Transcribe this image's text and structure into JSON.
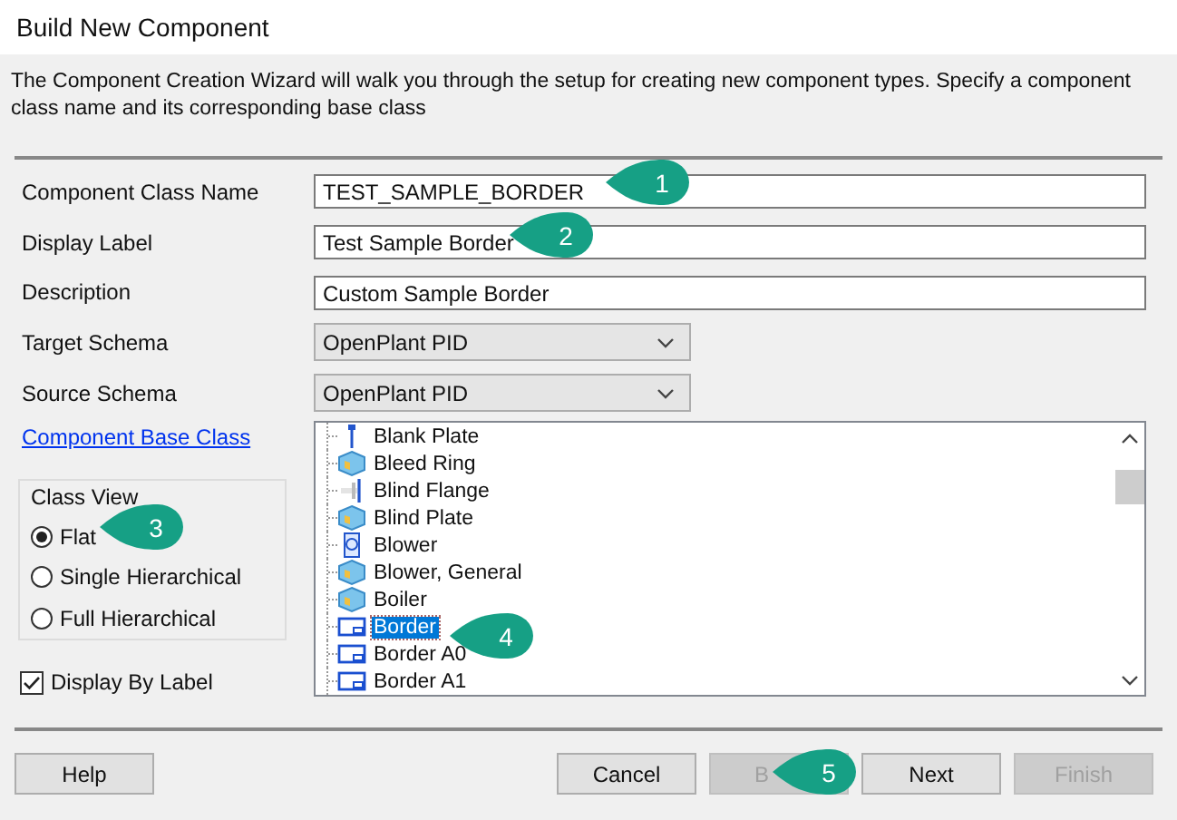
{
  "window": {
    "title": "Build New Component"
  },
  "intro": "The Component Creation Wizard will walk you through the setup for creating new component types.  Specify a component class name and its corresponding base class",
  "fields": [
    {
      "kind": "text",
      "label": "Component Class Name",
      "value": "TEST_SAMPLE_BORDER"
    },
    {
      "kind": "text",
      "label": "Display Label",
      "value": "Test Sample Border"
    },
    {
      "kind": "text",
      "label": "Description",
      "value": "Custom Sample Border"
    },
    {
      "kind": "select",
      "label": "Target Schema",
      "value": "OpenPlant PID"
    },
    {
      "kind": "select",
      "label": "Source Schema",
      "value": "OpenPlant PID"
    }
  ],
  "base_class_link": "Component Base Class",
  "class_view": {
    "title": "Class View",
    "options": [
      {
        "label": "Flat",
        "selected": true
      },
      {
        "label": "Single Hierarchical",
        "selected": false
      },
      {
        "label": "Full Hierarchical",
        "selected": false
      }
    ]
  },
  "display_by_label": {
    "label": "Display By Label",
    "checked": true
  },
  "tree": [
    {
      "label": "Blank Plate",
      "kind": "pin",
      "selected": false
    },
    {
      "label": "Bleed Ring",
      "kind": "cube",
      "selected": false
    },
    {
      "label": "Blind Flange",
      "kind": "flange",
      "selected": false
    },
    {
      "label": "Blind Plate",
      "kind": "cube",
      "selected": false
    },
    {
      "label": "Blower",
      "kind": "blower",
      "selected": false
    },
    {
      "label": "Blower, General",
      "kind": "cube",
      "selected": false
    },
    {
      "label": "Boiler",
      "kind": "cube",
      "selected": false
    },
    {
      "label": "Border",
      "kind": "frame",
      "selected": true
    },
    {
      "label": "Border A0",
      "kind": "frame",
      "selected": false
    },
    {
      "label": "Border A1",
      "kind": "frame",
      "selected": false
    }
  ],
  "buttons": [
    {
      "label": "Help",
      "disabled": false
    },
    {
      "label": "Cancel",
      "disabled": false
    },
    {
      "label": "B",
      "disabled": true
    },
    {
      "label": "Next",
      "disabled": false
    },
    {
      "label": "Finish",
      "disabled": true
    }
  ],
  "callouts": [
    {
      "label": "1"
    },
    {
      "label": "2"
    },
    {
      "label": "3"
    },
    {
      "label": "4"
    },
    {
      "label": "5"
    }
  ]
}
